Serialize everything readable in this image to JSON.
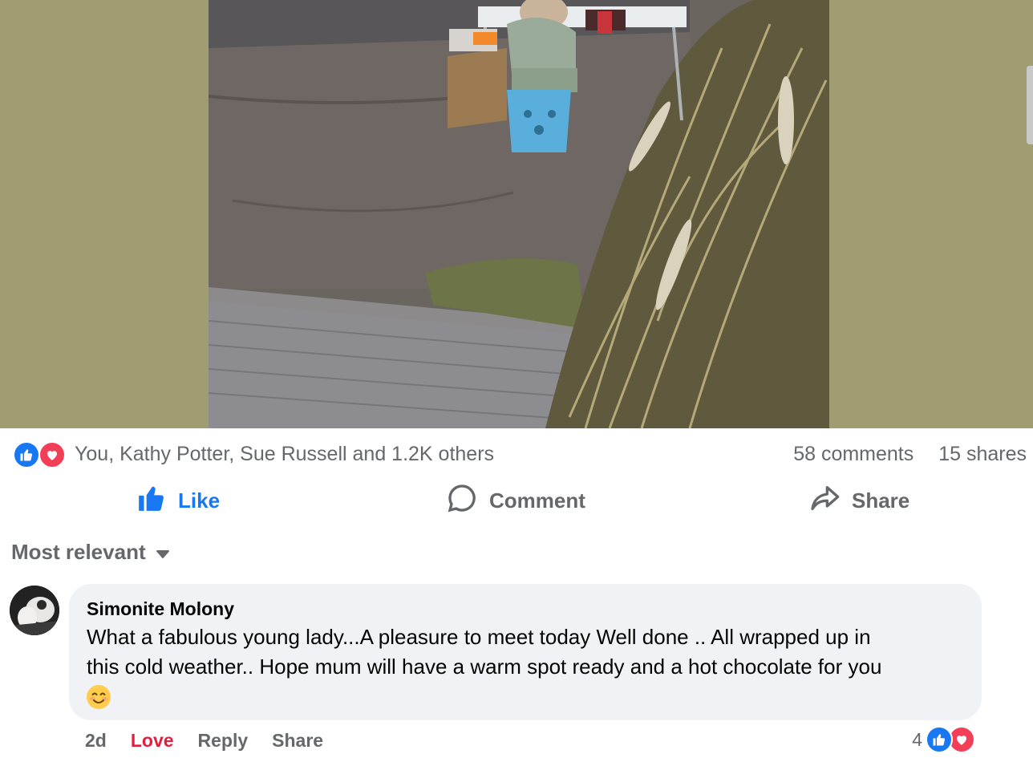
{
  "post": {
    "reactions_summary": "You, Kathy Potter, Sue Russell and 1.2K others",
    "comments_count": "58 comments",
    "shares_count": "15 shares"
  },
  "actions": {
    "like": "Like",
    "comment": "Comment",
    "share": "Share"
  },
  "sort_label": "Most relevant",
  "comment": {
    "author": "Simonite Molony",
    "text": "What a fabulous young lady...A pleasure to meet today Well done .. All wrapped up in\nthis cold weather.. Hope mum will have a warm spot ready and a hot chocolate for you",
    "emoji": "smiling-face-icon",
    "age": "2d",
    "love": "Love",
    "reply": "Reply",
    "share": "Share",
    "reaction_count": "4"
  },
  "colors": {
    "accent": "#1877f2",
    "love": "#f33e58",
    "love_text": "#e41e3f",
    "muted": "#65676b",
    "bubble": "#f0f2f5",
    "photo_bg": "#9f9d71"
  }
}
